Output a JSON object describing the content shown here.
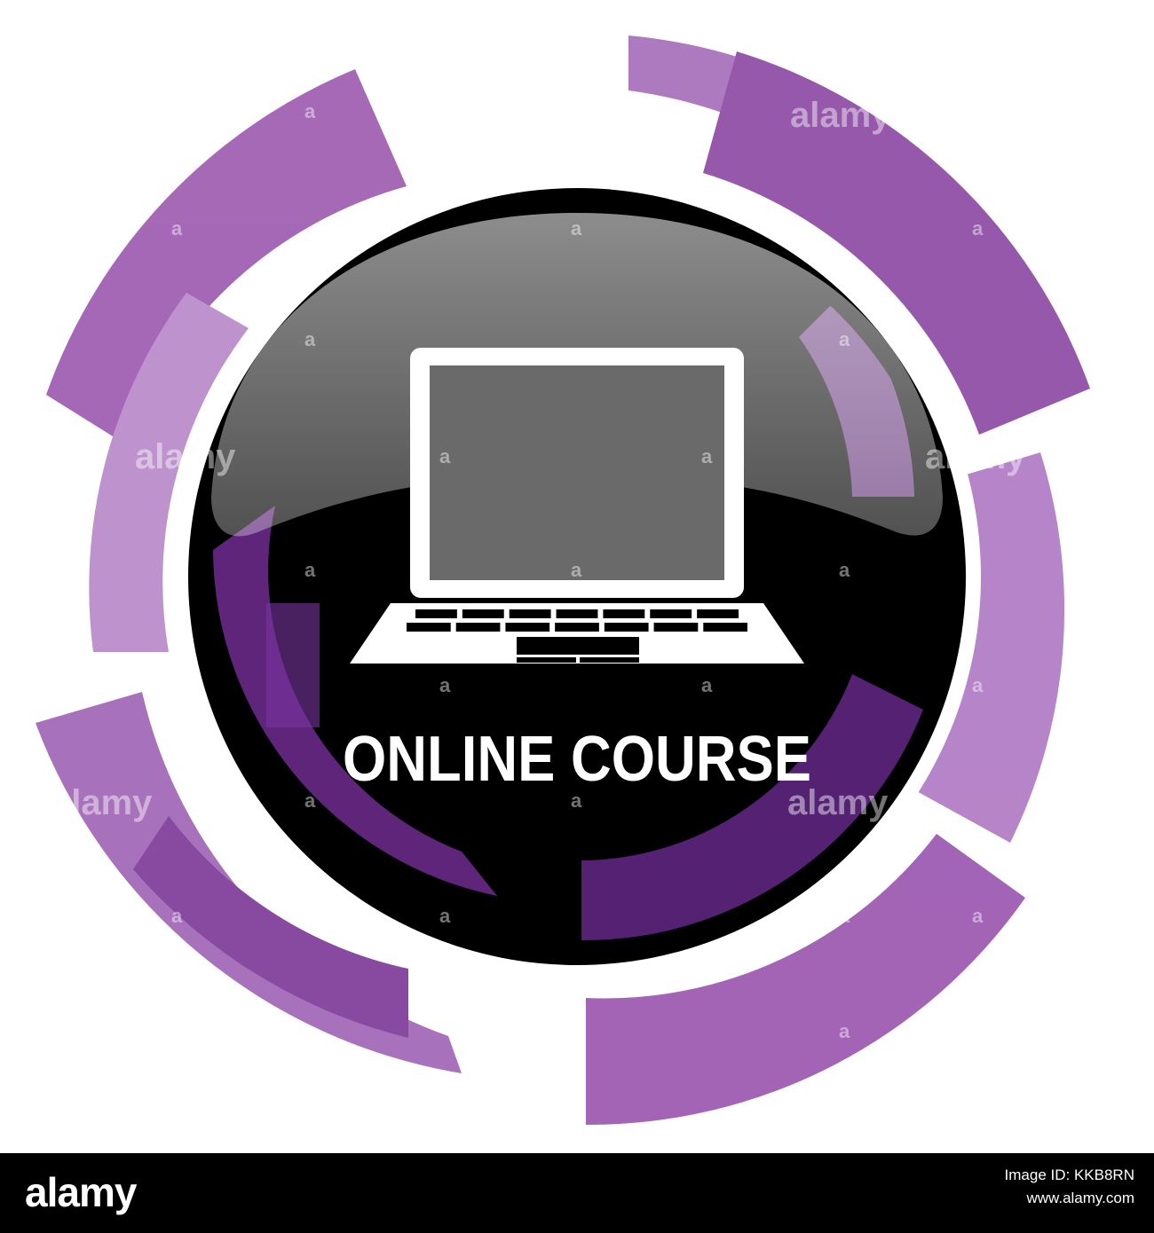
{
  "icon": {
    "caption": "ONLINE COURSE",
    "symbol": "laptop-icon"
  },
  "watermark": {
    "text": "alamy",
    "mark": "a"
  },
  "footer": {
    "logo": "alamy",
    "image_id": "Image ID: KKB8RN",
    "site": "www.alamy.com"
  },
  "colors": {
    "purple_light": "#b27fc2",
    "purple_mid": "#9b58ae",
    "purple_dark": "#6c2a88",
    "button_core": "#000000",
    "footer_bg": "#000000"
  }
}
